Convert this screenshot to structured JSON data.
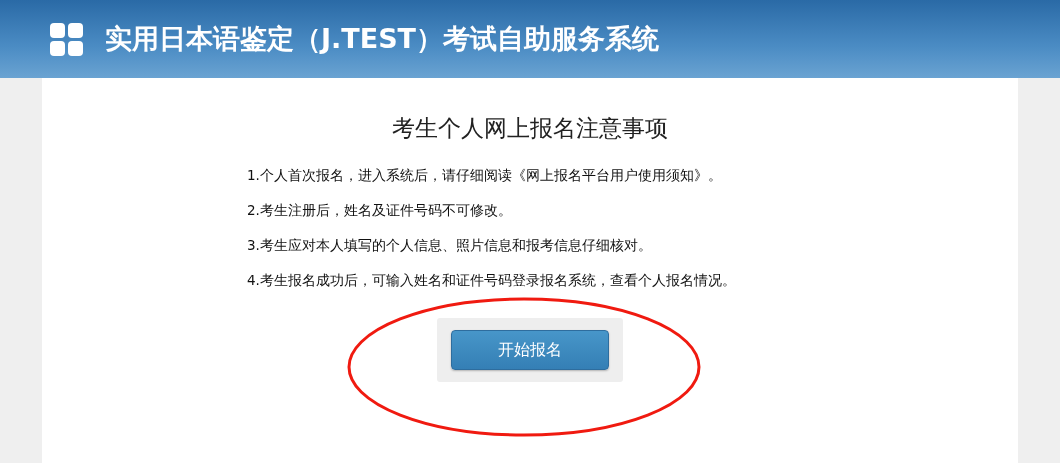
{
  "header": {
    "title": "实用日本语鉴定（J.TEST）考试自助服务系统"
  },
  "notice": {
    "title": "考生个人网上报名注意事项",
    "items": [
      "1.个人首次报名，进入系统后，请仔细阅读《网上报名平台用户使用须知》。",
      "2.考生注册后，姓名及证件号码不可修改。",
      "3.考生应对本人填写的个人信息、照片信息和报考信息仔细核对。",
      "4.考生报名成功后，可输入姓名和证件号码登录报名系统，查看个人报名情况。"
    ],
    "button": "开始报名"
  }
}
